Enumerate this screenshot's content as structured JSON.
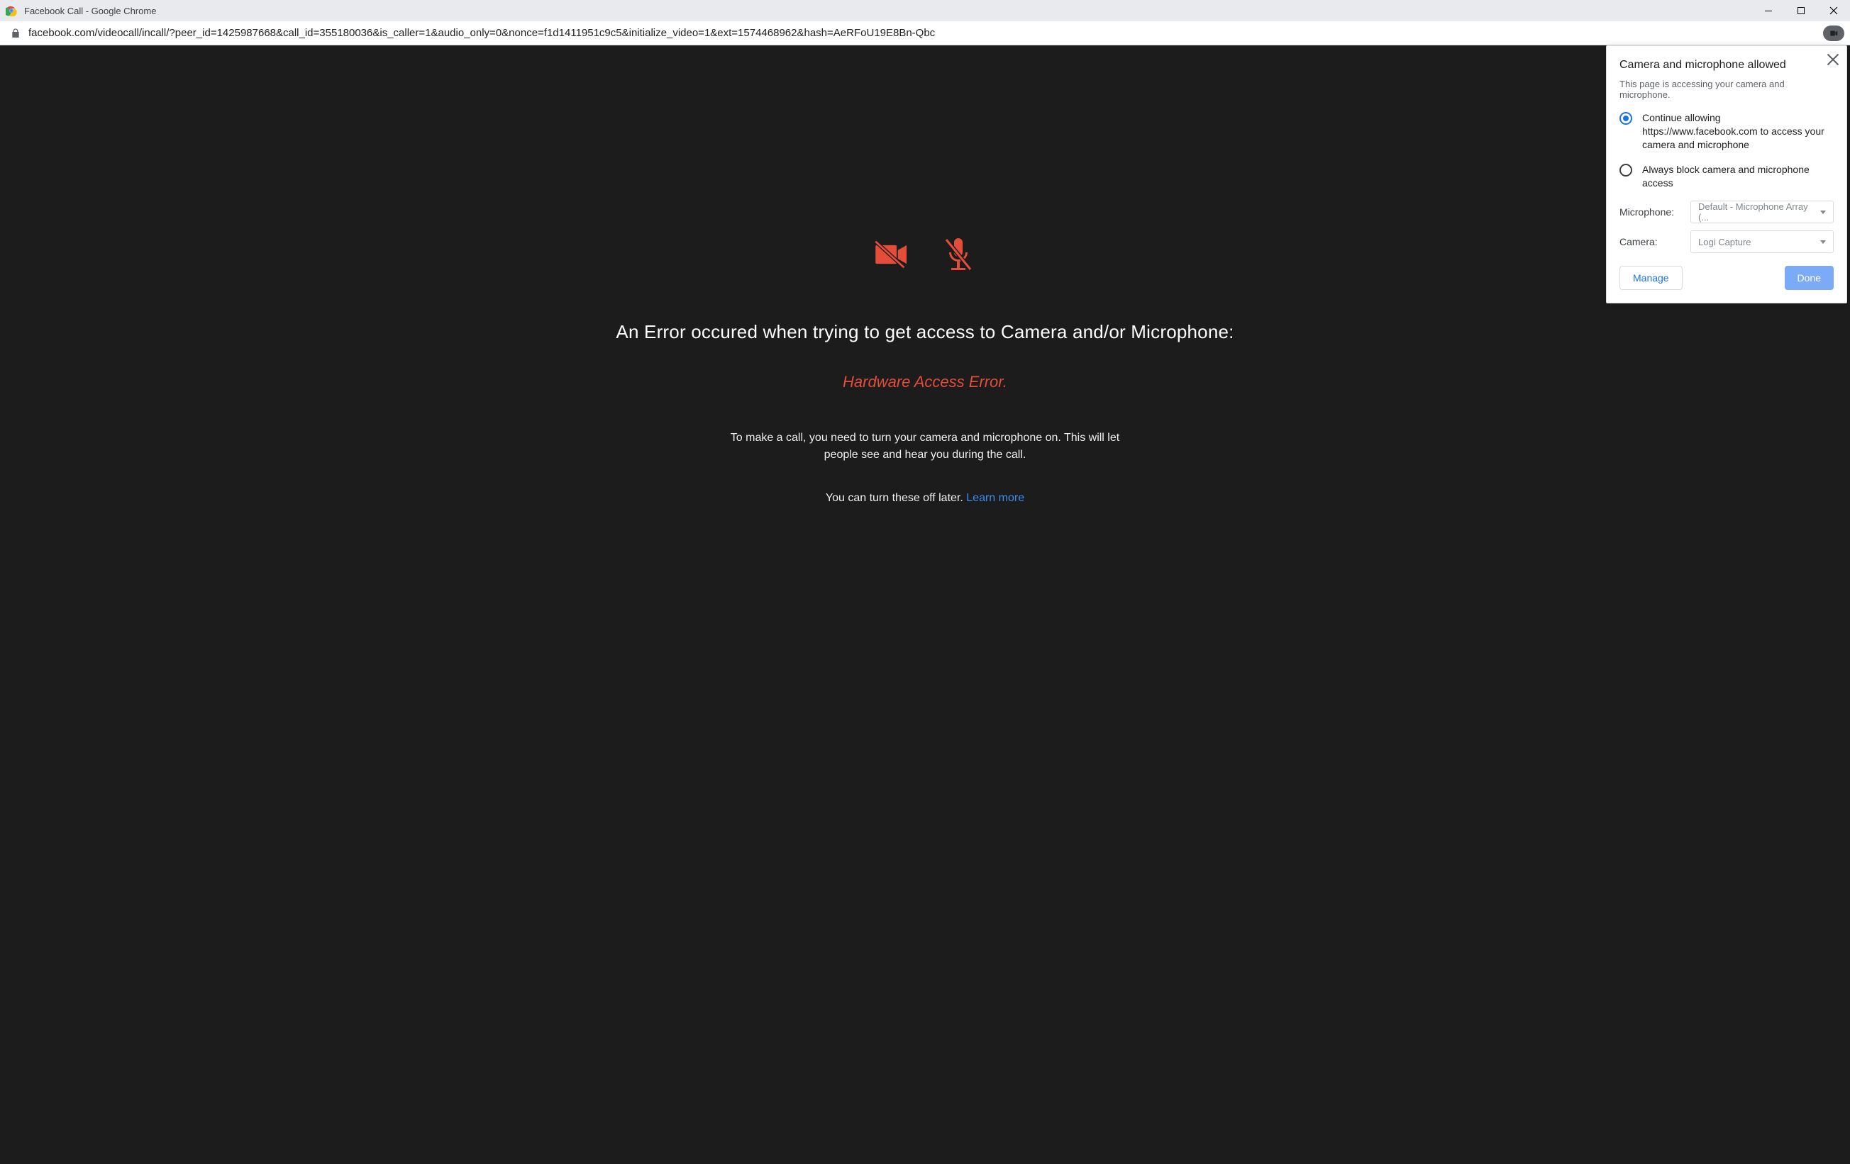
{
  "window": {
    "title": "Facebook Call - Google Chrome"
  },
  "address": {
    "url": "facebook.com/videocall/incall/?peer_id=1425987668&call_id=355180036&is_caller=1&audio_only=0&nonce=f1d1411951c9c5&initialize_video=1&ext=1574468962&hash=AeRFoU19E8Bn-Qbc"
  },
  "error": {
    "title": "An Error occured when trying to get access to Camera and/or Microphone:",
    "subtitle": "Hardware Access Error.",
    "desc": "To make a call, you need to turn your camera and microphone on. This will let people see and hear you during the call.",
    "later": "You can turn these off later. ",
    "learn_more": "Learn more"
  },
  "popover": {
    "title": "Camera and microphone allowed",
    "subtitle": "This page is accessing your camera and microphone.",
    "option_allow": "Continue allowing https://www.facebook.com to access your camera and microphone",
    "option_block": "Always block camera and microphone access",
    "mic_label": "Microphone:",
    "mic_value": "Default - Microphone Array (...",
    "cam_label": "Camera:",
    "cam_value": "Logi Capture",
    "manage": "Manage",
    "done": "Done"
  },
  "colors": {
    "error_red": "#e44d3a",
    "link_blue": "#3b8eea",
    "chrome_blue": "#1a73e8"
  }
}
